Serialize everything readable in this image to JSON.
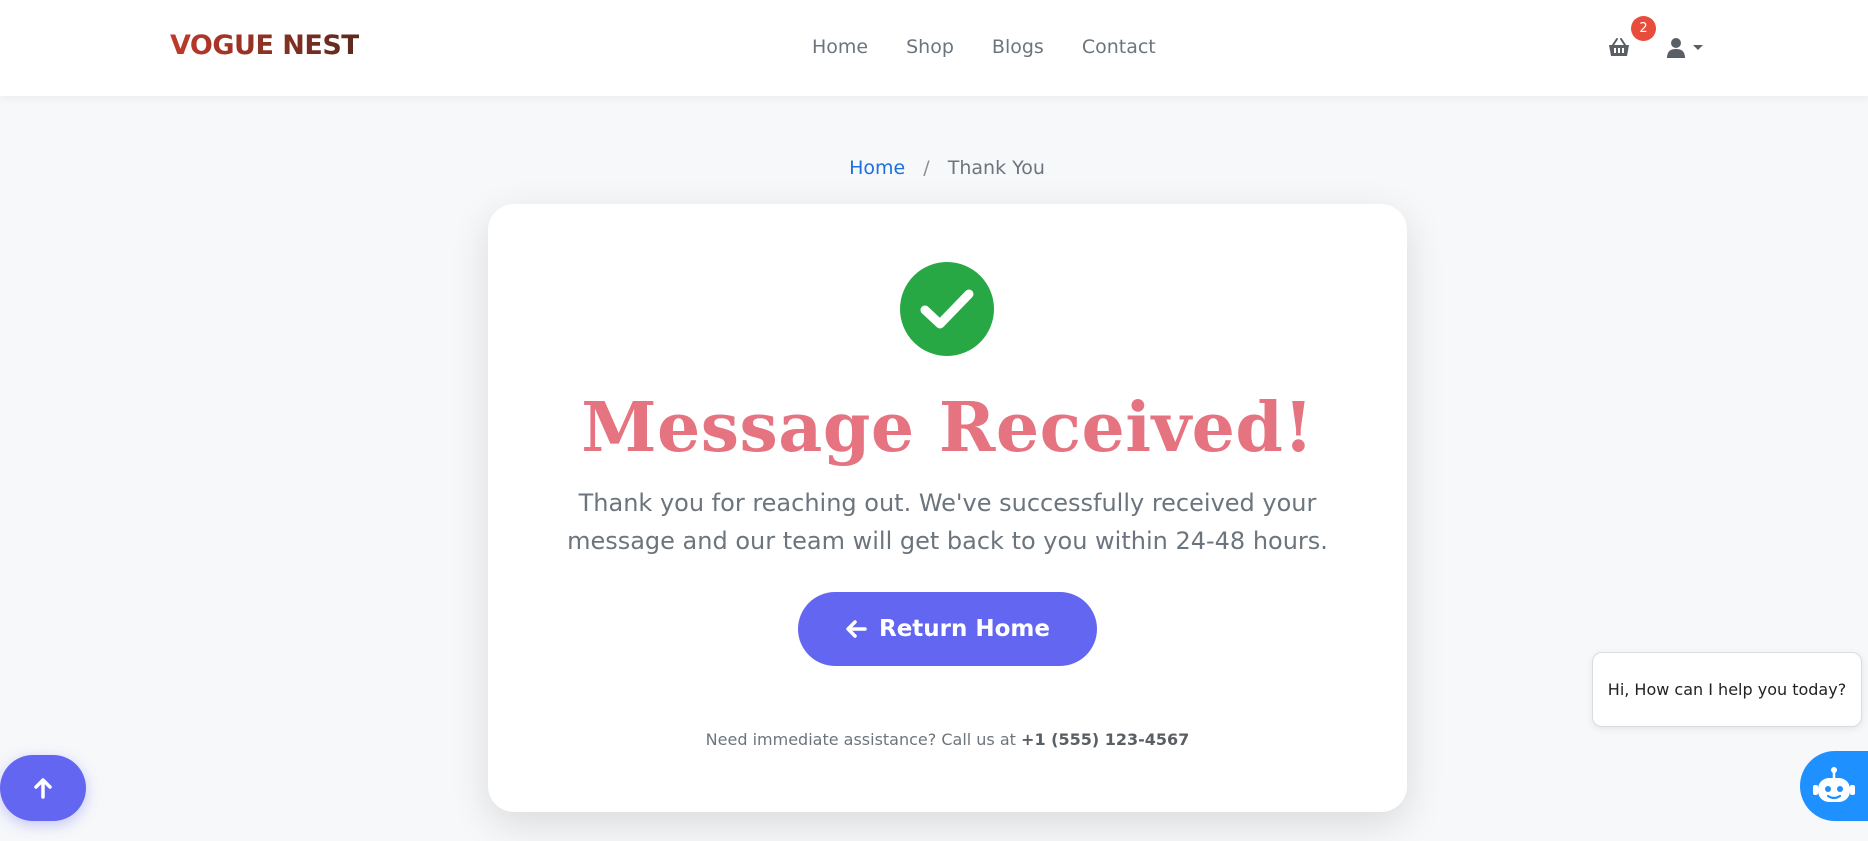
{
  "brand": {
    "name": "VOGUE NEST"
  },
  "nav": {
    "items": [
      {
        "label": "Home"
      },
      {
        "label": "Shop"
      },
      {
        "label": "Blogs"
      },
      {
        "label": "Contact"
      }
    ]
  },
  "cart": {
    "icon": "basket-icon",
    "count": "2"
  },
  "user": {
    "icon": "user-icon",
    "caret": "caret-down-icon"
  },
  "breadcrumb": {
    "home": "Home",
    "separator": "/",
    "current": "Thank You"
  },
  "card": {
    "icon": "check-circle-icon",
    "title": "Message Received!",
    "text": "Thank you for reaching out. We've successfully received your message and our team will get back to you within 24-48 hours.",
    "button": {
      "icon": "arrow-left-icon",
      "label": "Return Home"
    },
    "assist_prefix": "Need immediate assistance? Call us at",
    "assist_phone": "+1 (555) 123-4567"
  },
  "chat": {
    "greeting": "Hi, How can I help you today?",
    "icon": "robot-icon"
  },
  "scroll_top": {
    "icon": "arrow-up-icon"
  },
  "colors": {
    "primary": "#6366f1",
    "success": "#28a745",
    "title": "#e57380",
    "badge": "#e74c3c",
    "chat": "#1e90ff",
    "link": "#1e6fe0"
  }
}
